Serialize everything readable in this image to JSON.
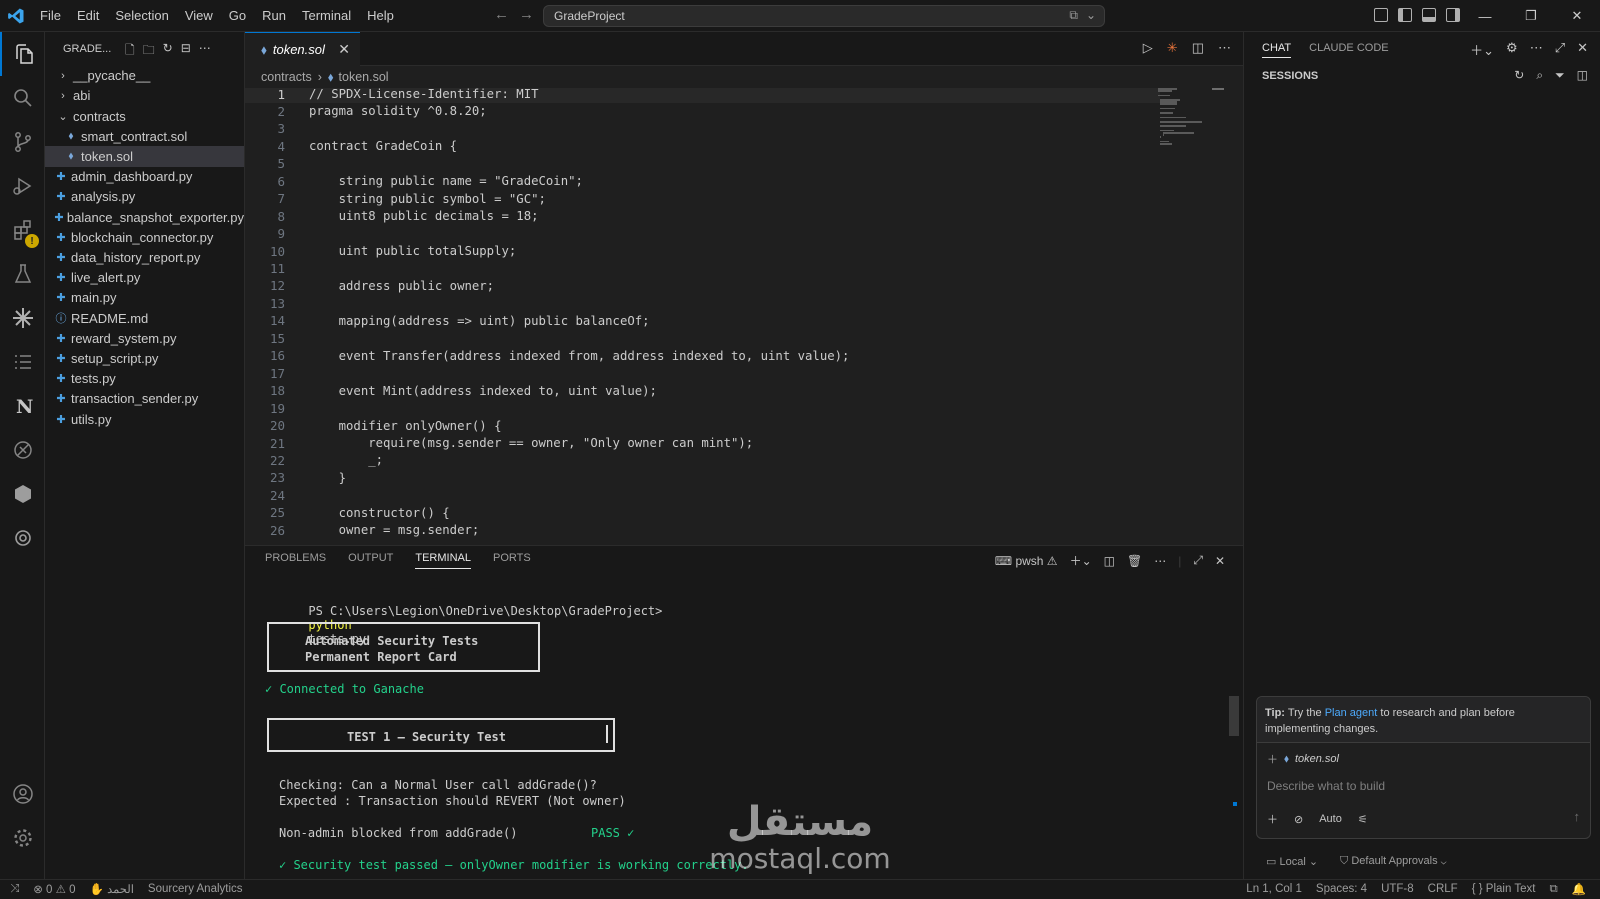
{
  "titlebar": {
    "menu": [
      "File",
      "Edit",
      "Selection",
      "View",
      "Go",
      "Run",
      "Terminal",
      "Help"
    ],
    "search_text": "GradeProject"
  },
  "sidebar": {
    "title": "GRADE...",
    "items": [
      {
        "label": "__pycache__",
        "kind": "folder",
        "expanded": false
      },
      {
        "label": "abi",
        "kind": "folder",
        "expanded": false
      },
      {
        "label": "contracts",
        "kind": "folder",
        "expanded": true
      },
      {
        "label": "smart_contract.sol",
        "kind": "sol"
      },
      {
        "label": "token.sol",
        "kind": "sol",
        "selected": true
      },
      {
        "label": "admin_dashboard.py",
        "kind": "py"
      },
      {
        "label": "analysis.py",
        "kind": "py"
      },
      {
        "label": "balance_snapshot_exporter.py",
        "kind": "py"
      },
      {
        "label": "blockchain_connector.py",
        "kind": "py"
      },
      {
        "label": "data_history_report.py",
        "kind": "py"
      },
      {
        "label": "live_alert.py",
        "kind": "py"
      },
      {
        "label": "main.py",
        "kind": "py"
      },
      {
        "label": "README.md",
        "kind": "md"
      },
      {
        "label": "reward_system.py",
        "kind": "py"
      },
      {
        "label": "setup_script.py",
        "kind": "py"
      },
      {
        "label": "tests.py",
        "kind": "py"
      },
      {
        "label": "transaction_sender.py",
        "kind": "py"
      },
      {
        "label": "utils.py",
        "kind": "py"
      }
    ]
  },
  "editor": {
    "tab_label": "token.sol",
    "breadcrumb_folder": "contracts",
    "breadcrumb_file": "token.sol",
    "lines": [
      "// SPDX-License-Identifier: MIT",
      "pragma solidity ^0.8.20;",
      "",
      "contract GradeCoin {",
      "",
      "    string public name = \"GradeCoin\";",
      "    string public symbol = \"GC\";",
      "    uint8 public decimals = 18;",
      "",
      "    uint public totalSupply;",
      "",
      "    address public owner;",
      "",
      "    mapping(address => uint) public balanceOf;",
      "",
      "    event Transfer(address indexed from, address indexed to, uint value);",
      "",
      "    event Mint(address indexed to, uint value);",
      "",
      "    modifier onlyOwner() {",
      "        require(msg.sender == owner, \"Only owner can mint\");",
      "        _;",
      "    }",
      "",
      "    constructor() {",
      "    owner = msg.sender;"
    ],
    "line_numbers": [
      "1",
      "2",
      "3",
      "4",
      "5",
      "6",
      "7",
      "8",
      "9",
      "10",
      "11",
      "12",
      "13",
      "14",
      "15",
      "16",
      "17",
      "18",
      "19",
      "20",
      "21",
      "22",
      "23",
      "24",
      "25",
      "26"
    ]
  },
  "panel": {
    "tabs": [
      "PROBLEMS",
      "OUTPUT",
      "TERMINAL",
      "PORTS"
    ],
    "active_tab": "TERMINAL",
    "shell_label": "pwsh",
    "terminal": {
      "prompt": "PS C:\\Users\\Legion\\OneDrive\\Desktop\\GradeProject>",
      "command_exe": "python",
      "command_arg": "tests.py",
      "box1_line1": "Automated Security Tests",
      "box1_line2": "Permanent Report Card",
      "connected": "✓ Connected to Ganache",
      "box2_title": "TEST 1 — Security Test",
      "checking": "Checking: Can a Normal User call addGrade()?",
      "expected": "Expected : Transaction should REVERT (Not owner)",
      "result_label": "Non-admin blocked from addGrade()",
      "result_status": "PASS ✓",
      "passed_msg": "✓ Security test passed — onlyOwner modifier is working correctly."
    }
  },
  "chat": {
    "tabs": [
      "CHAT",
      "CLAUDE CODE"
    ],
    "sessions_title": "SESSIONS",
    "tip_prefix": "Tip:",
    "tip_pre_link": " Try the ",
    "tip_link": "Plan agent",
    "tip_post_link": " to research and plan before implementing changes.",
    "attached_file": "token.sol",
    "placeholder": "Describe what to build",
    "mode": "Auto",
    "footer_local": "Local",
    "footer_approvals": "Default Approvals"
  },
  "statusbar": {
    "errors": "0",
    "warnings": "0",
    "arabic_label": "الحمد",
    "extension": "Sourcery Analytics",
    "position": "Ln 1, Col 1",
    "spaces": "Spaces: 4",
    "encoding": "UTF-8",
    "eol": "CRLF",
    "language": "Plain Text"
  },
  "watermark": {
    "arabic": "مستقل",
    "latin": "mostaql.com"
  },
  "colors": {
    "accent": "#0078d4",
    "terminal_green": "#23d18b",
    "terminal_yellow": "#f5f543",
    "warning": "#cca700"
  }
}
